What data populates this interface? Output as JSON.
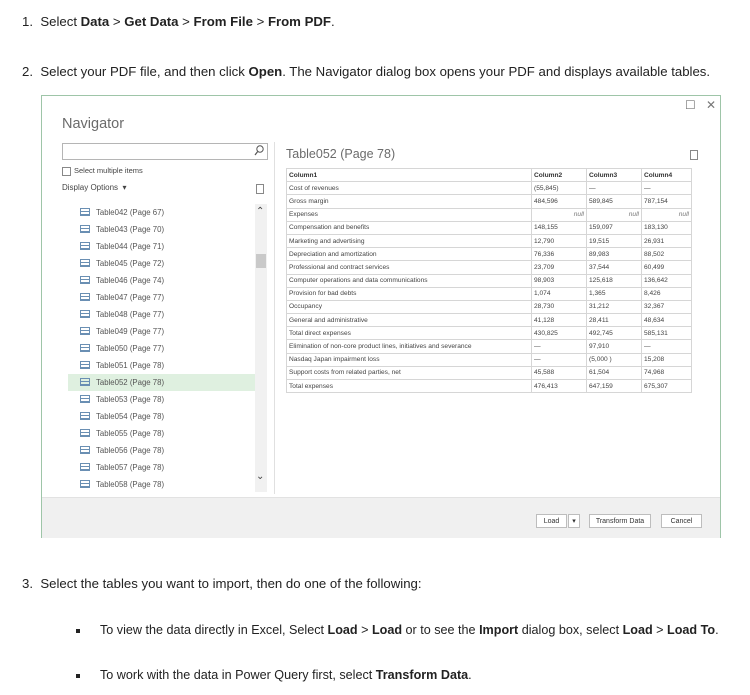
{
  "steps": [
    {
      "num": "1.",
      "pre": "Select ",
      "b1": "Data",
      "s1": " > ",
      "b2": "Get Data",
      "s2": " > ",
      "b3": "From File",
      "s3": " > ",
      "b4": "From PDF",
      "end": "."
    },
    {
      "num": "2.",
      "pre": "Select your PDF file, and then click ",
      "b1": "Open",
      "post": ". The Navigator dialog box opens your PDF and displays available tables."
    },
    {
      "num": "3.",
      "text": "Select the tables you want to import, then do one of the following:"
    }
  ],
  "bullets": [
    {
      "pre": "To view the data directly in Excel, Select ",
      "b1": "Load",
      "s1": " > ",
      "b2": "Load",
      "mid": " or to see the ",
      "b3": "Import",
      "mid2": " dialog box, select ",
      "b4": "Load",
      "s2": " > ",
      "b5": "Load To",
      "end": "."
    },
    {
      "pre": "To work with the data in Power Query first, select ",
      "b1": "Transform Data",
      "end": "."
    }
  ],
  "navigator": {
    "title": "Navigator",
    "search_placeholder": "",
    "select_multiple_label": "Select multiple items",
    "display_options_label": "Display Options",
    "display_options_caret": "▾",
    "tree_items": [
      "Table042 (Page 67)",
      "Table043 (Page 70)",
      "Table044 (Page 71)",
      "Table045 (Page 72)",
      "Table046 (Page 74)",
      "Table047 (Page 77)",
      "Table048 (Page 77)",
      "Table049 (Page 77)",
      "Table050 (Page 77)",
      "Table051 (Page 78)",
      "Table052 (Page 78)",
      "Table053 (Page 78)",
      "Table054 (Page 78)",
      "Table055 (Page 78)",
      "Table056 (Page 78)",
      "Table057 (Page 78)",
      "Table058 (Page 78)"
    ],
    "selected_index": 10,
    "preview_title": "Table052 (Page 78)",
    "columns": [
      "Column1",
      "Column2",
      "Column3",
      "Column4"
    ],
    "rows": [
      [
        "Cost of revenues",
        "(55,845)",
        "—",
        "—"
      ],
      [
        "Gross margin",
        "484,596",
        "589,845",
        "787,154"
      ],
      [
        "Expenses",
        "null",
        "null",
        "null"
      ],
      [
        "Compensation and benefits",
        "148,155",
        "159,097",
        "183,130"
      ],
      [
        "Marketing and advertising",
        "12,790",
        "19,515",
        "26,931"
      ],
      [
        "Depreciation and amortization",
        "76,336",
        "89,983",
        "88,502"
      ],
      [
        "Professional and contract services",
        "23,709",
        "37,544",
        "60,499"
      ],
      [
        "Computer operations and data communications",
        "98,903",
        "125,618",
        "136,642"
      ],
      [
        "Provision for bad debts",
        "1,074",
        "1,365",
        "8,426"
      ],
      [
        "Occupancy",
        "28,730",
        "31,212",
        "32,367"
      ],
      [
        "General and administrative",
        "41,128",
        "28,411",
        "48,634"
      ],
      [
        "Total direct expenses",
        "430,825",
        "492,745",
        "585,131"
      ],
      [
        "Elimination of non-core product lines, initiatives and severance",
        "—",
        "97,910",
        "—"
      ],
      [
        "Nasdaq Japan impairment loss",
        "—",
        "(5,000 )",
        "15,208"
      ],
      [
        "Support costs from related parties, net",
        "45,588",
        "61,504",
        "74,968"
      ],
      [
        "Total expenses",
        "476,413",
        "647,159",
        "675,307"
      ]
    ],
    "buttons": {
      "load": "Load",
      "load_dropdown": "▾",
      "transform": "Transform Data",
      "cancel": "Cancel"
    },
    "window": {
      "maximize": "☐",
      "close": "✕"
    }
  }
}
